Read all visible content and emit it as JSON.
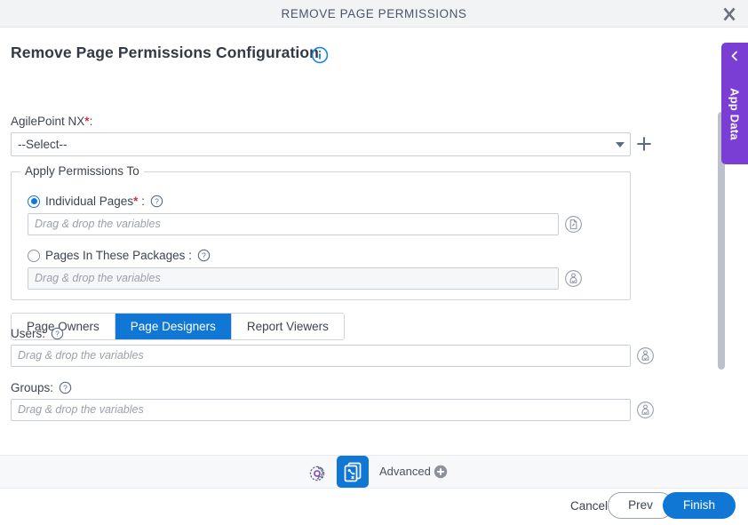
{
  "window": {
    "title": "REMOVE PAGE PERMISSIONS",
    "close_icon": "close-x-icon"
  },
  "page": {
    "heading": "Remove Page Permissions Configuration",
    "heading_info_icon": "info-circle-icon"
  },
  "agilepoint": {
    "label": "AgilePoint NX",
    "required_marker": "*",
    "label_colon": ":",
    "selected_value": "--Select--",
    "caret_icon": "chevron-down-icon",
    "add_icon": "plus-icon"
  },
  "apply_permissions": {
    "legend": "Apply Permissions To",
    "options": [
      {
        "id": "individual-pages",
        "label": "Individual Pages",
        "required_marker": "*",
        "label_colon": ":",
        "selected": true,
        "help_icon": "question-circle-icon",
        "input_placeholder": "Drag & drop the variables",
        "input_value": "",
        "picker_icon": "page-picker-icon"
      },
      {
        "id": "pages-in-packages",
        "label": "Pages In These Packages",
        "required_marker": "",
        "label_colon": ":",
        "selected": false,
        "help_icon": "question-circle-icon",
        "input_placeholder": "Drag & drop the variables",
        "input_value": "",
        "picker_icon": "package-picker-icon"
      }
    ]
  },
  "tabs": {
    "items": [
      {
        "label": "Page Owners",
        "active": false
      },
      {
        "label": "Page Designers",
        "active": true
      },
      {
        "label": "Report Viewers",
        "active": false
      }
    ]
  },
  "permission_fields": [
    {
      "id": "users",
      "label": "Users:",
      "help_icon": "question-circle-icon",
      "placeholder": "Drag & drop the variables",
      "value": "",
      "picker_icon": "user-picker-icon"
    },
    {
      "id": "groups",
      "label": "Groups:",
      "help_icon": "question-circle-icon",
      "placeholder": "Drag & drop the variables",
      "value": "",
      "picker_icon": "user-picker-icon"
    }
  ],
  "toolbar": {
    "gear_icon": "gear-settings-icon",
    "copy_icon": "copy-config-icon",
    "advanced_label": "Advanced",
    "advanced_plus_icon": "plus-circle-icon"
  },
  "footer": {
    "cancel_label": "Cancel",
    "prev_label": "Prev",
    "finish_label": "Finish"
  },
  "app_data_panel": {
    "label": "App Data",
    "chevron_icon": "chevron-left-icon"
  },
  "colors": {
    "accent_blue": "#1078d4",
    "purple": "#7b3ed4",
    "required_red": "#d0323c",
    "titlebar_bg": "#f2f3f5",
    "toolbar_bg": "#f7f8fa",
    "text": "#3d4450",
    "placeholder": "#9aa1ab",
    "border": "#c9ced6"
  }
}
